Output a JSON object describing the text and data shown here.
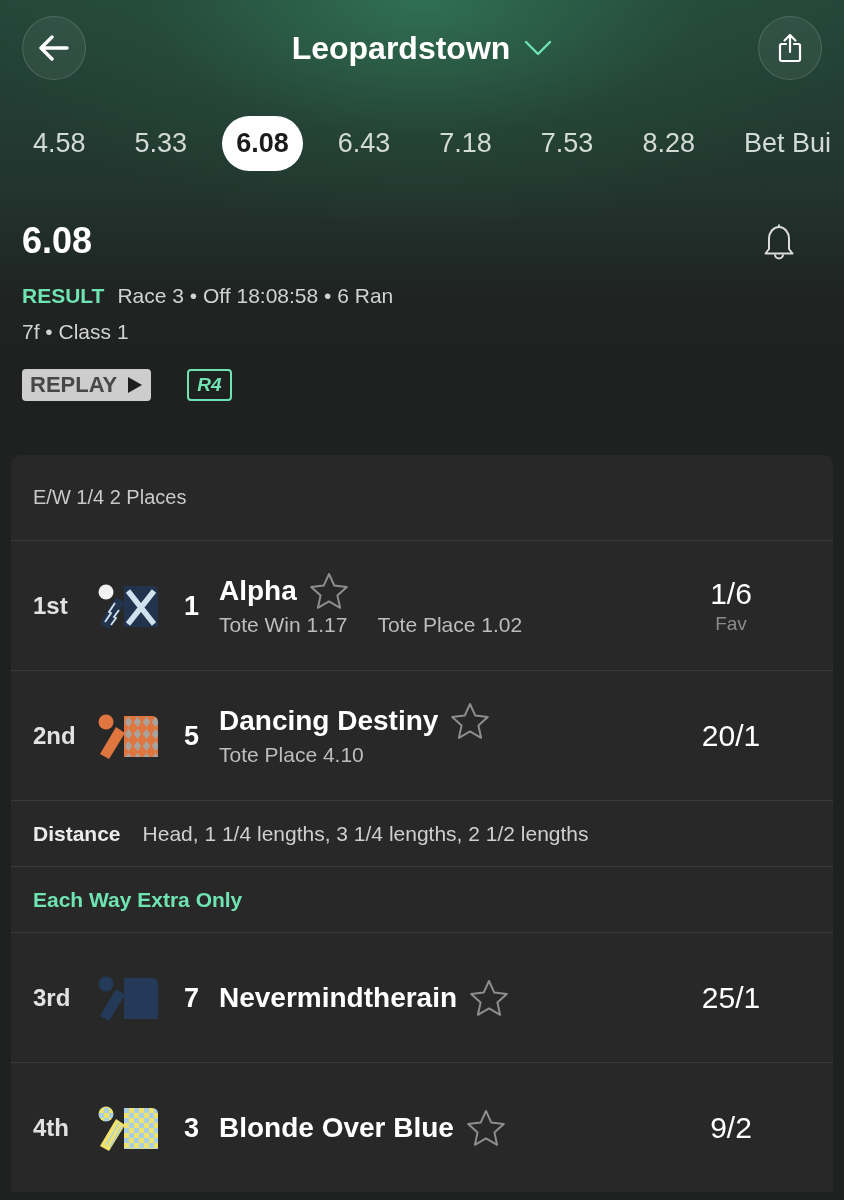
{
  "header": {
    "venue": "Leopardstown"
  },
  "race_tabs": [
    {
      "label": "4.58",
      "selected": false
    },
    {
      "label": "5.33",
      "selected": false
    },
    {
      "label": "6.08",
      "selected": true
    },
    {
      "label": "6.43",
      "selected": false
    },
    {
      "label": "7.18",
      "selected": false
    },
    {
      "label": "7.53",
      "selected": false
    },
    {
      "label": "8.28",
      "selected": false
    },
    {
      "label": "Bet Bui",
      "selected": false
    }
  ],
  "race": {
    "title": "6.08",
    "status": "RESULT",
    "details": "Race 3 • Off 18:08:58 • 6 Ran",
    "conditions": "7f • Class 1",
    "replay_button": "REPLAY",
    "badge": "R4"
  },
  "results": {
    "terms": "E/W 1/4 2 Places",
    "rows": [
      {
        "kind": "runner",
        "position": "1st",
        "number": "1",
        "name": "Alpha",
        "starred": false,
        "tote": [
          "Tote Win 1.17",
          "Tote Place 1.02"
        ],
        "odds": "1/6",
        "note": "Fav",
        "silk": {
          "kind": "cross",
          "color": "#22344d",
          "trim": {
            "color": "#cfe2ee"
          }
        }
      },
      {
        "kind": "runner",
        "position": "2nd",
        "number": "5",
        "name": "Dancing Destiny",
        "starred": false,
        "tote": [
          "Tote Place 4.10"
        ],
        "odds": "20/1",
        "silk": {
          "kind": "argyle",
          "color": "#e0763f",
          "trim": {
            "color": "#a8a39c"
          }
        }
      },
      {
        "kind": "distance",
        "label": "Distance",
        "value": "Head, 1 1/4 lengths, 3 1/4 lengths, 2 1/2 lengths"
      },
      {
        "kind": "section",
        "label": "Each Way Extra Only"
      },
      {
        "kind": "runner",
        "position": "3rd",
        "number": "7",
        "name": "Nevermindtherain",
        "starred": false,
        "odds": "25/1",
        "silk": {
          "kind": "plain",
          "color": "#243a58"
        }
      },
      {
        "kind": "runner",
        "position": "4th",
        "number": "3",
        "name": "Blonde Over Blue",
        "starred": false,
        "odds": "9/2",
        "silk": {
          "kind": "check",
          "color": "#f0e36c",
          "trim": {
            "color": "#a9cfe4"
          }
        }
      }
    ]
  }
}
